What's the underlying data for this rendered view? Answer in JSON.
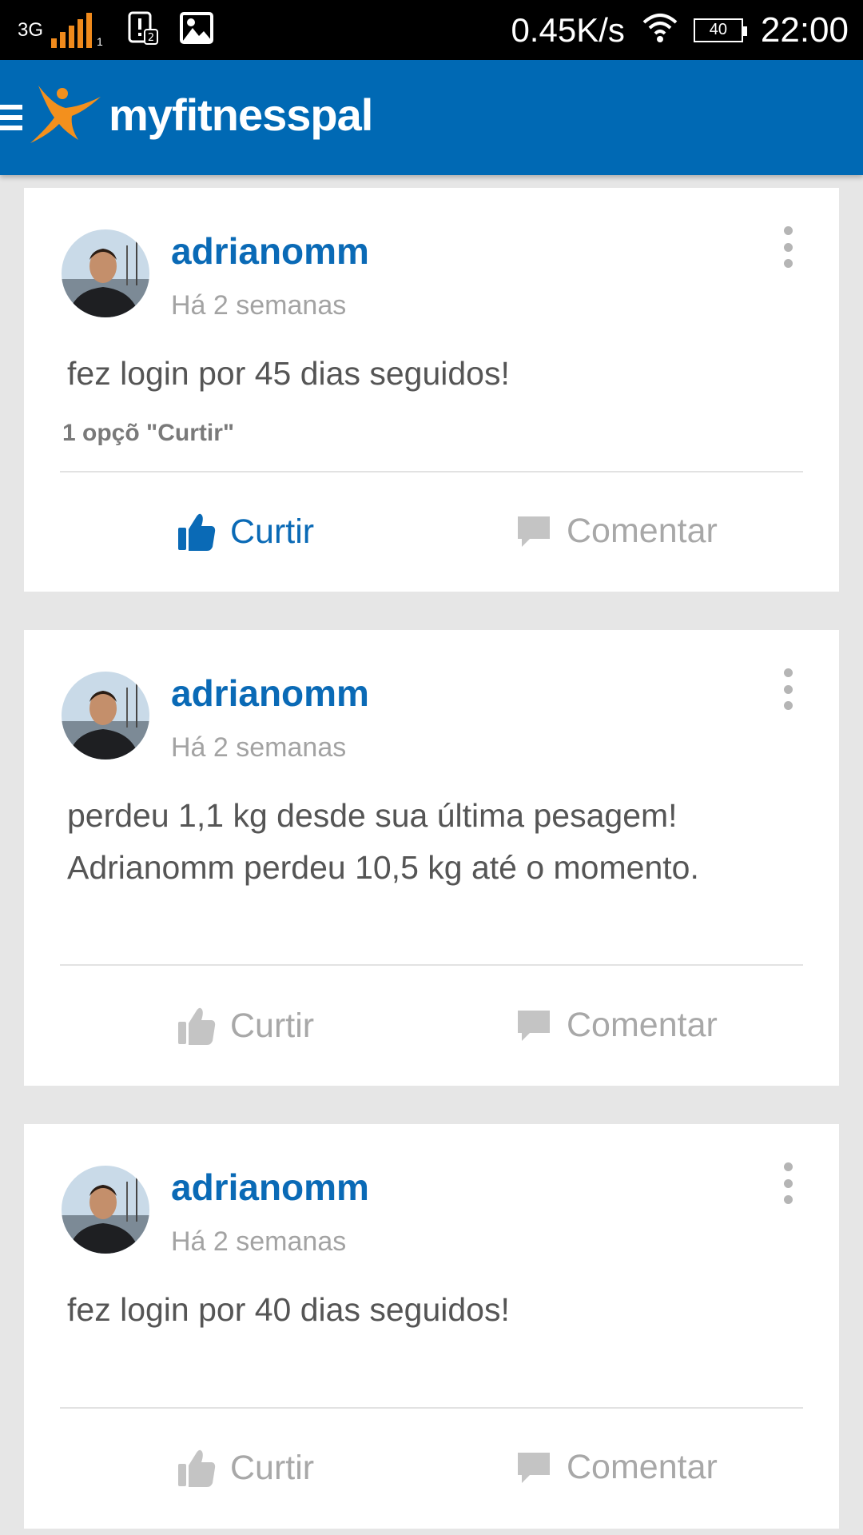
{
  "status_bar": {
    "network": "3G",
    "signal_sub": "1",
    "speed": "0.45K/s",
    "battery": "40",
    "time": "22:00",
    "signal_color": "#f08a1c"
  },
  "app_bar": {
    "logo_text": "myfitnesspal",
    "bg_color": "#0069b4",
    "accent_color": "#f3901d"
  },
  "feed": [
    {
      "username": "adrianomm",
      "timestamp": "Há 2 semanas",
      "text": "fez login por 45 dias seguidos!",
      "likes_text": "1 opçõ \"Curtir\"",
      "like_label": "Curtir",
      "comment_label": "Comentar",
      "liked": true
    },
    {
      "username": "adrianomm",
      "timestamp": "Há 2 semanas",
      "text_line1": "perdeu 1,1 kg desde sua última pesagem!",
      "text_line2": "Adrianomm perdeu 10,5 kg até o momento.",
      "like_label": "Curtir",
      "comment_label": "Comentar",
      "liked": false
    },
    {
      "username": "adrianomm",
      "timestamp": "Há 2 semanas",
      "text": "fez login por 40 dias seguidos!",
      "like_label": "Curtir",
      "comment_label": "Comentar",
      "liked": false
    }
  ]
}
